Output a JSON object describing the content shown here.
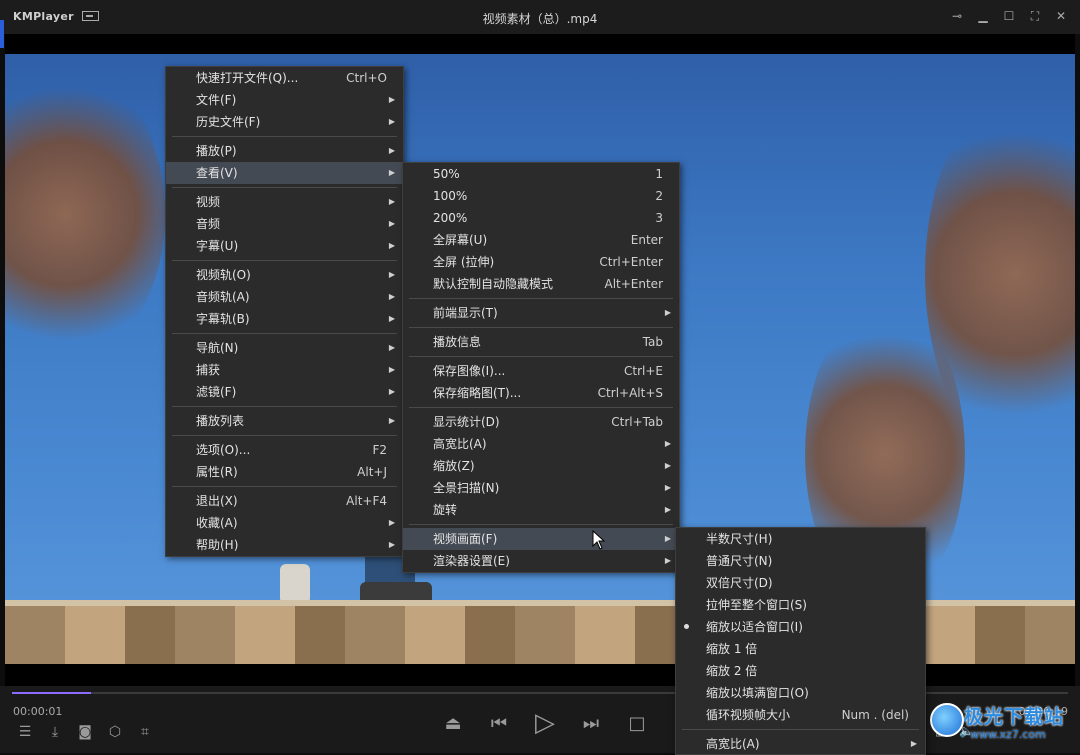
{
  "app": {
    "logo": "KMPlayer",
    "title": "视频素材（总）.mp4",
    "window_controls": [
      "pin-icon",
      "minimize-icon",
      "maximize-icon",
      "fullscreen-icon",
      "close-icon"
    ]
  },
  "player": {
    "time_current": "00:00:01",
    "time_total": "00:00:19",
    "progress": 0.075
  },
  "menu_main": {
    "items": [
      {
        "label": "快速打开文件(Q)...",
        "shortcut": "Ctrl+O",
        "submenu": false
      },
      {
        "label": "文件(F)",
        "shortcut": "",
        "submenu": true
      },
      {
        "label": "历史文件(F)",
        "shortcut": "",
        "submenu": true
      },
      {
        "sep": true
      },
      {
        "label": "播放(P)",
        "shortcut": "",
        "submenu": true
      },
      {
        "label": "查看(V)",
        "shortcut": "",
        "submenu": true,
        "highlighted": true
      },
      {
        "sep": true
      },
      {
        "label": "视频",
        "shortcut": "",
        "submenu": true
      },
      {
        "label": "音频",
        "shortcut": "",
        "submenu": true
      },
      {
        "label": "字幕(U)",
        "shortcut": "",
        "submenu": true
      },
      {
        "sep": true
      },
      {
        "label": "视频轨(O)",
        "shortcut": "",
        "submenu": true
      },
      {
        "label": "音频轨(A)",
        "shortcut": "",
        "submenu": true
      },
      {
        "label": "字幕轨(B)",
        "shortcut": "",
        "submenu": true
      },
      {
        "sep": true
      },
      {
        "label": "导航(N)",
        "shortcut": "",
        "submenu": true
      },
      {
        "label": "捕获",
        "shortcut": "",
        "submenu": true
      },
      {
        "label": "滤镜(F)",
        "shortcut": "",
        "submenu": true
      },
      {
        "sep": true
      },
      {
        "label": "播放列表",
        "shortcut": "",
        "submenu": true
      },
      {
        "sep": true
      },
      {
        "label": "选项(O)...",
        "shortcut": "F2",
        "submenu": false
      },
      {
        "label": "属性(R)",
        "shortcut": "Alt+J",
        "submenu": false
      },
      {
        "sep": true
      },
      {
        "label": "退出(X)",
        "shortcut": "Alt+F4",
        "submenu": false
      },
      {
        "label": "收藏(A)",
        "shortcut": "",
        "submenu": true
      },
      {
        "label": "帮助(H)",
        "shortcut": "",
        "submenu": true
      }
    ]
  },
  "menu_view": {
    "items": [
      {
        "label": "50%",
        "shortcut": "1",
        "submenu": false
      },
      {
        "label": "100%",
        "shortcut": "2",
        "submenu": false
      },
      {
        "label": "200%",
        "shortcut": "3",
        "submenu": false
      },
      {
        "label": "全屏幕(U)",
        "shortcut": "Enter",
        "submenu": false
      },
      {
        "label": "全屏 (拉伸)",
        "shortcut": "Ctrl+Enter",
        "submenu": false
      },
      {
        "label": "默认控制自动隐藏模式",
        "shortcut": "Alt+Enter",
        "submenu": false
      },
      {
        "sep": true
      },
      {
        "label": "前端显示(T)",
        "shortcut": "",
        "submenu": true
      },
      {
        "sep": true
      },
      {
        "label": "播放信息",
        "shortcut": "Tab",
        "submenu": false
      },
      {
        "sep": true
      },
      {
        "label": "保存图像(I)...",
        "shortcut": "Ctrl+E",
        "submenu": false
      },
      {
        "label": "保存缩略图(T)...",
        "shortcut": "Ctrl+Alt+S",
        "submenu": false
      },
      {
        "sep": true
      },
      {
        "label": "显示统计(D)",
        "shortcut": "Ctrl+Tab",
        "submenu": false
      },
      {
        "label": "高宽比(A)",
        "shortcut": "",
        "submenu": true
      },
      {
        "label": "缩放(Z)",
        "shortcut": "",
        "submenu": true
      },
      {
        "label": "全景扫描(N)",
        "shortcut": "",
        "submenu": true
      },
      {
        "label": "旋转",
        "shortcut": "",
        "submenu": true
      },
      {
        "sep": true
      },
      {
        "label": "视频画面(F)",
        "shortcut": "",
        "submenu": true,
        "highlighted": true
      },
      {
        "label": "渲染器设置(E)",
        "shortcut": "",
        "submenu": true
      }
    ]
  },
  "menu_frame": {
    "items": [
      {
        "label": "半数尺寸(H)",
        "shortcut": "",
        "submenu": false
      },
      {
        "label": "普通尺寸(N)",
        "shortcut": "",
        "submenu": false
      },
      {
        "label": "双倍尺寸(D)",
        "shortcut": "",
        "submenu": false
      },
      {
        "label": "拉伸至整个窗口(S)",
        "shortcut": "",
        "submenu": false
      },
      {
        "label": "缩放以适合窗口(I)",
        "shortcut": "",
        "submenu": false,
        "checked": true
      },
      {
        "label": "缩放 1 倍",
        "shortcut": "",
        "submenu": false
      },
      {
        "label": "缩放 2 倍",
        "shortcut": "",
        "submenu": false
      },
      {
        "label": "缩放以填满窗口(O)",
        "shortcut": "",
        "submenu": false
      },
      {
        "label": "循环视频帧大小",
        "shortcut": "Num . (del)",
        "submenu": false
      },
      {
        "sep": true
      },
      {
        "label": "高宽比(A)",
        "shortcut": "",
        "submenu": true
      }
    ]
  },
  "watermark": {
    "text": "极光下载站",
    "url": "www.xz7.com"
  },
  "colors": {
    "progress": "#8c6bff",
    "menu_bg": "#2b2b2b",
    "menu_highlight": "#444a54"
  }
}
